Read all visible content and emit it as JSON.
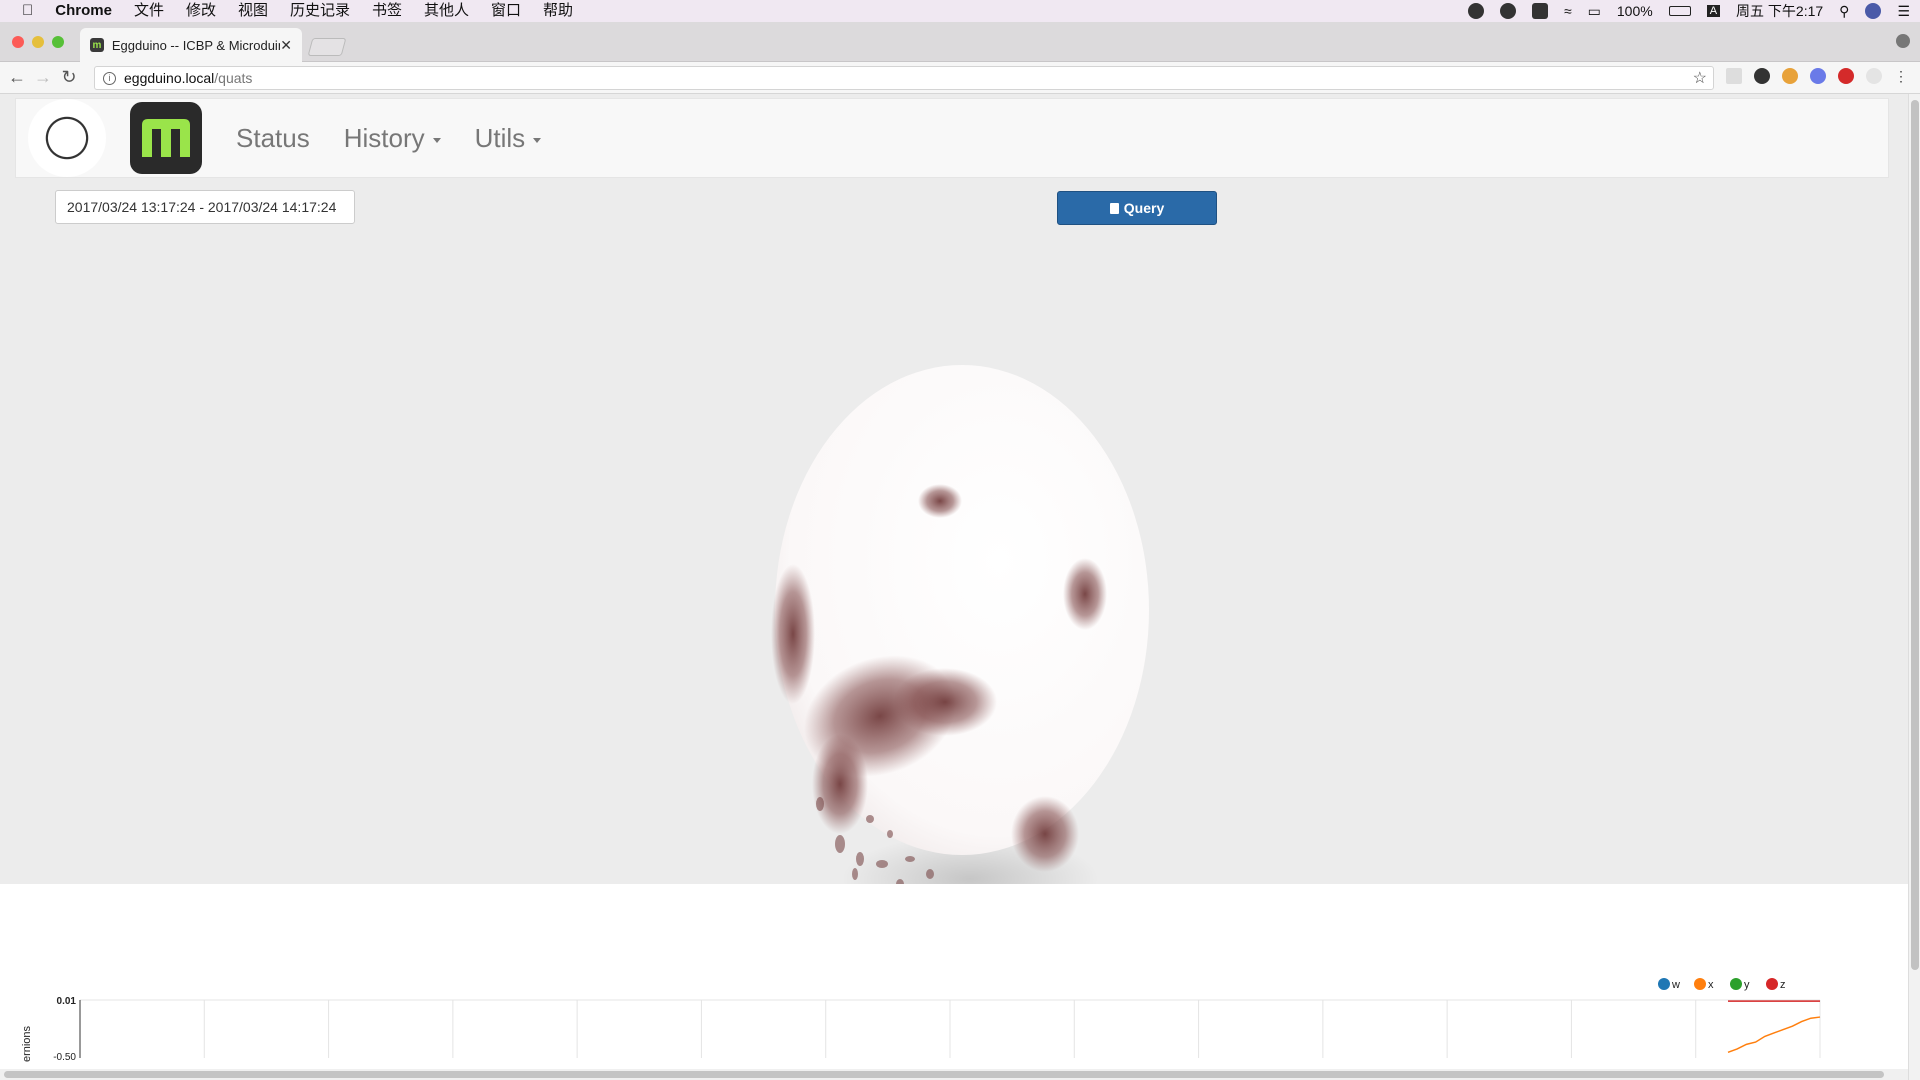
{
  "menubar": {
    "app": "Chrome",
    "items": [
      "文件",
      "修改",
      "视图",
      "历史记录",
      "书签",
      "其他人",
      "窗口",
      "帮助"
    ],
    "battery": "100%",
    "clock": "周五 下午2:17",
    "input_method": "A"
  },
  "browser": {
    "tab_title": "Eggduino -- ICBP & Microduino",
    "url_host": "eggduino.local",
    "url_path": "/quats"
  },
  "nav": {
    "links": [
      "Status",
      "History",
      "Utils"
    ]
  },
  "query": {
    "daterange": "2017/03/24 13:17:24 - 2017/03/24 14:17:24",
    "button_label": "Query"
  },
  "chart_data": {
    "type": "line",
    "ylabel": "ernions",
    "ytick_labels": [
      "0.01",
      "-0.50"
    ],
    "legend": [
      "w",
      "x",
      "y",
      "z"
    ],
    "colors": {
      "w": "#1f77b4",
      "x": "#ff7f0e",
      "y": "#2ca02c",
      "z": "#d62728"
    },
    "series": [
      {
        "name": "z",
        "values": [
          0.0,
          0.0,
          0.0,
          0.0,
          0.0,
          0.0,
          0.0,
          0.0,
          0.0,
          0.0,
          0.0
        ]
      },
      {
        "name": "x",
        "values": [
          -0.45,
          -0.42,
          -0.38,
          -0.36,
          -0.31,
          -0.28,
          -0.25,
          -0.22,
          -0.18,
          -0.15,
          -0.14
        ]
      }
    ]
  }
}
